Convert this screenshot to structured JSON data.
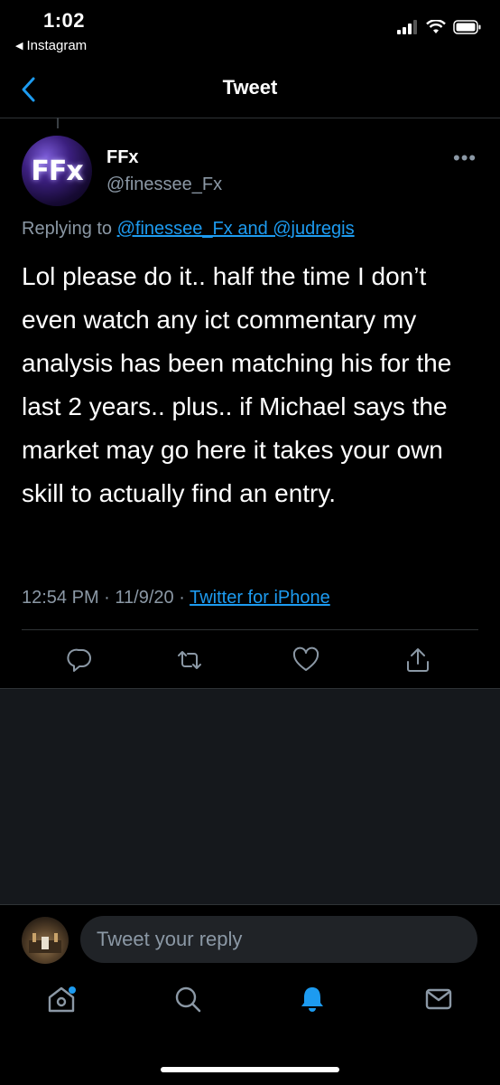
{
  "status": {
    "time": "1:02",
    "back_app": "Instagram"
  },
  "header": {
    "title": "Tweet"
  },
  "author": {
    "avatar_text": "FFx",
    "name": "FFx",
    "handle": "@finessee_Fx"
  },
  "replying": {
    "prefix": "Replying to",
    "targets": "@finessee_Fx and @judregis"
  },
  "tweet": {
    "text": "Lol please do it..  half the time I don’t even watch any ict commentary my analysis has been matching his for the last 2 years.. plus.. if Michael says the market may go here it takes your own skill to actually find an entry."
  },
  "meta": {
    "time": "12:54 PM",
    "sep1": "·",
    "date": "11/9/20",
    "sep2": "·",
    "source": "Twitter for iPhone"
  },
  "reply": {
    "placeholder": "Tweet your reply"
  },
  "icons": {
    "back": "chevron-left-icon",
    "more": "more-horizontal-icon",
    "actions": [
      "reply-icon",
      "retweet-icon",
      "like-icon",
      "share-icon"
    ],
    "tabs": [
      "home-icon",
      "search-icon",
      "notifications-icon",
      "messages-icon"
    ]
  },
  "colors": {
    "accent": "#1d9bf0",
    "secondary_text": "#8b98a5",
    "background": "#000000"
  }
}
